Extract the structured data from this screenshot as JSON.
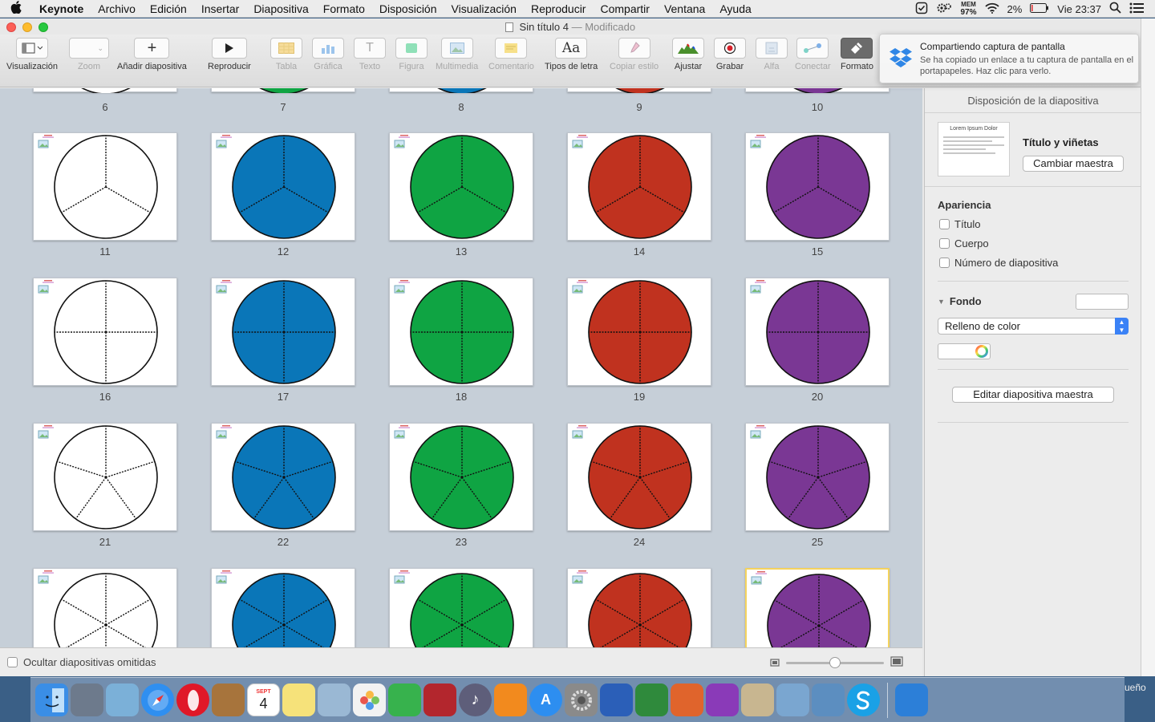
{
  "menubar": {
    "items": [
      "Keynote",
      "Archivo",
      "Edición",
      "Insertar",
      "Diapositiva",
      "Formato",
      "Disposición",
      "Visualización",
      "Reproducir",
      "Compartir",
      "Ventana",
      "Ayuda"
    ],
    "status": {
      "mem_label": "MEM",
      "mem_value": "97%",
      "battery": "2%",
      "clock": "Vie 23:37"
    }
  },
  "window": {
    "title": "Sin título 4",
    "separator": "—",
    "state": "Modificado"
  },
  "toolbar": {
    "items": [
      {
        "label": "Visualización",
        "icon": "view-icon",
        "disabled": false
      },
      {
        "label": "Zoom",
        "icon": "zoom-icon",
        "disabled": true
      },
      {
        "label": "Añadir diapositiva",
        "icon": "plus-icon",
        "disabled": false
      },
      {
        "label": "Reproducir",
        "icon": "play-icon",
        "disabled": false
      },
      {
        "label": "Tabla",
        "icon": "table-icon",
        "disabled": true
      },
      {
        "label": "Gráfica",
        "icon": "chart-icon",
        "disabled": true
      },
      {
        "label": "Texto",
        "icon": "text-icon",
        "disabled": true
      },
      {
        "label": "Figura",
        "icon": "shape-icon",
        "disabled": true
      },
      {
        "label": "Multimedia",
        "icon": "media-icon",
        "disabled": true
      },
      {
        "label": "Comentario",
        "icon": "comment-icon",
        "disabled": true
      },
      {
        "label": "Tipos de letra",
        "icon": "fonts-icon",
        "disabled": false
      },
      {
        "label": "Copiar estilo",
        "icon": "copy-style-icon",
        "disabled": true
      },
      {
        "label": "Ajustar",
        "icon": "adjust-icon",
        "disabled": false
      },
      {
        "label": "Grabar",
        "icon": "record-icon",
        "disabled": false
      },
      {
        "label": "Alfa",
        "icon": "alpha-icon",
        "disabled": true
      },
      {
        "label": "Conectar",
        "icon": "connect-icon",
        "disabled": true
      },
      {
        "label": "Formato",
        "icon": "format-icon",
        "disabled": false
      }
    ],
    "fonts_glyph": "Aa",
    "text_glyph": "T"
  },
  "slides": {
    "top_row_numbers": [
      "6",
      "7",
      "8",
      "9",
      "10"
    ],
    "rows": [
      {
        "segments": 3,
        "items": [
          {
            "num": "11",
            "color": "#ffffff"
          },
          {
            "num": "12",
            "color": "#0a76b8"
          },
          {
            "num": "13",
            "color": "#0fa443"
          },
          {
            "num": "14",
            "color": "#c0321f"
          },
          {
            "num": "15",
            "color": "#7a3794"
          }
        ]
      },
      {
        "segments": 4,
        "items": [
          {
            "num": "16",
            "color": "#ffffff"
          },
          {
            "num": "17",
            "color": "#0a76b8"
          },
          {
            "num": "18",
            "color": "#0fa443"
          },
          {
            "num": "19",
            "color": "#c0321f"
          },
          {
            "num": "20",
            "color": "#7a3794"
          }
        ]
      },
      {
        "segments": 5,
        "items": [
          {
            "num": "21",
            "color": "#ffffff"
          },
          {
            "num": "22",
            "color": "#0a76b8"
          },
          {
            "num": "23",
            "color": "#0fa443"
          },
          {
            "num": "24",
            "color": "#c0321f"
          },
          {
            "num": "25",
            "color": "#7a3794"
          }
        ]
      },
      {
        "segments": 6,
        "items": [
          {
            "num": "",
            "color": "#ffffff"
          },
          {
            "num": "",
            "color": "#0a76b8"
          },
          {
            "num": "",
            "color": "#0fa443"
          },
          {
            "num": "",
            "color": "#c0321f"
          },
          {
            "num": "",
            "color": "#7a3794",
            "selected": true
          }
        ]
      }
    ]
  },
  "bottom": {
    "hide_skipped_label": "Ocultar diapositivas omitidas",
    "zoom_level": 0.5
  },
  "inspector": {
    "heading": "Disposición de la diapositiva",
    "master_name": "Título y viñetas",
    "change_master": "Cambiar maestra",
    "thumb_title": "Lorem Ipsum Dolor",
    "appearance_title": "Apariencia",
    "checkboxes": [
      "Título",
      "Cuerpo",
      "Número de diapositiva"
    ],
    "background_title": "Fondo",
    "fill_option": "Relleno de color",
    "edit_master": "Editar diapositiva maestra"
  },
  "notification": {
    "title": "Compartiendo captura de pantalla",
    "body": "Se ha copiado un enlace a tu captura de pantalla en el portapapeles. Haz clic para verlo."
  },
  "dock": {
    "calendar_month": "SEPT",
    "calendar_day": "4",
    "right_text": "ueño",
    "apps": [
      {
        "name": "finder-icon",
        "color": "#3a8ee6"
      },
      {
        "name": "launchpad-icon",
        "color": "#6d7a8c"
      },
      {
        "name": "preview-icon",
        "color": "#7bb0d8"
      },
      {
        "name": "safari-icon",
        "color": "#2f8ff0"
      },
      {
        "name": "opera-icon",
        "color": "#e01828"
      },
      {
        "name": "contacts-icon",
        "color": "#a7743c"
      },
      {
        "name": "calendar-icon",
        "color": "#ffffff"
      },
      {
        "name": "notes-icon",
        "color": "#f6e27a"
      },
      {
        "name": "image-capture-icon",
        "color": "#9ab8d4"
      },
      {
        "name": "photos-icon",
        "color": "#f2f2f2"
      },
      {
        "name": "facetime-icon",
        "color": "#37b24d"
      },
      {
        "name": "photo-booth-icon",
        "color": "#b3262d"
      },
      {
        "name": "itunes-icon",
        "color": "#5e5e7a"
      },
      {
        "name": "ibooks-icon",
        "color": "#f28a1e"
      },
      {
        "name": "app-store-icon",
        "color": "#2d8ef0"
      },
      {
        "name": "system-preferences-icon",
        "color": "#8a8a8a"
      },
      {
        "name": "word-icon",
        "color": "#2b5fb8"
      },
      {
        "name": "excel-icon",
        "color": "#2f8a3c"
      },
      {
        "name": "powerpoint-icon",
        "color": "#e0642c"
      },
      {
        "name": "onenote-icon",
        "color": "#8a3ab8"
      },
      {
        "name": "misc-app-icon",
        "color": "#c8b690"
      },
      {
        "name": "image-viewer-icon",
        "color": "#7aa6d0"
      },
      {
        "name": "preview2-icon",
        "color": "#5c8ec0"
      },
      {
        "name": "skype-icon",
        "color": "#1aa1e6"
      },
      {
        "name": "keynote-icon",
        "color": "#2c7fd8"
      }
    ]
  }
}
